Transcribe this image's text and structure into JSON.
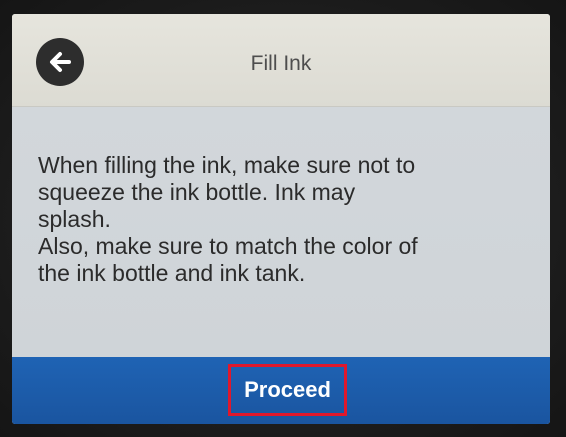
{
  "header": {
    "back_icon": "arrow-left-icon",
    "title": "Fill Ink"
  },
  "message": {
    "text": "When filling the ink, make sure not to\nsqueeze the ink bottle. Ink may\nsplash.\nAlso, make sure to match the color of\nthe ink bottle and ink tank."
  },
  "footer": {
    "proceed_label": "Proceed"
  },
  "colors": {
    "header_bg": "#e2e1d9",
    "body_bg": "#d1d6da",
    "footer_bg": "#1d5fae",
    "highlight_border": "#e0182c"
  }
}
